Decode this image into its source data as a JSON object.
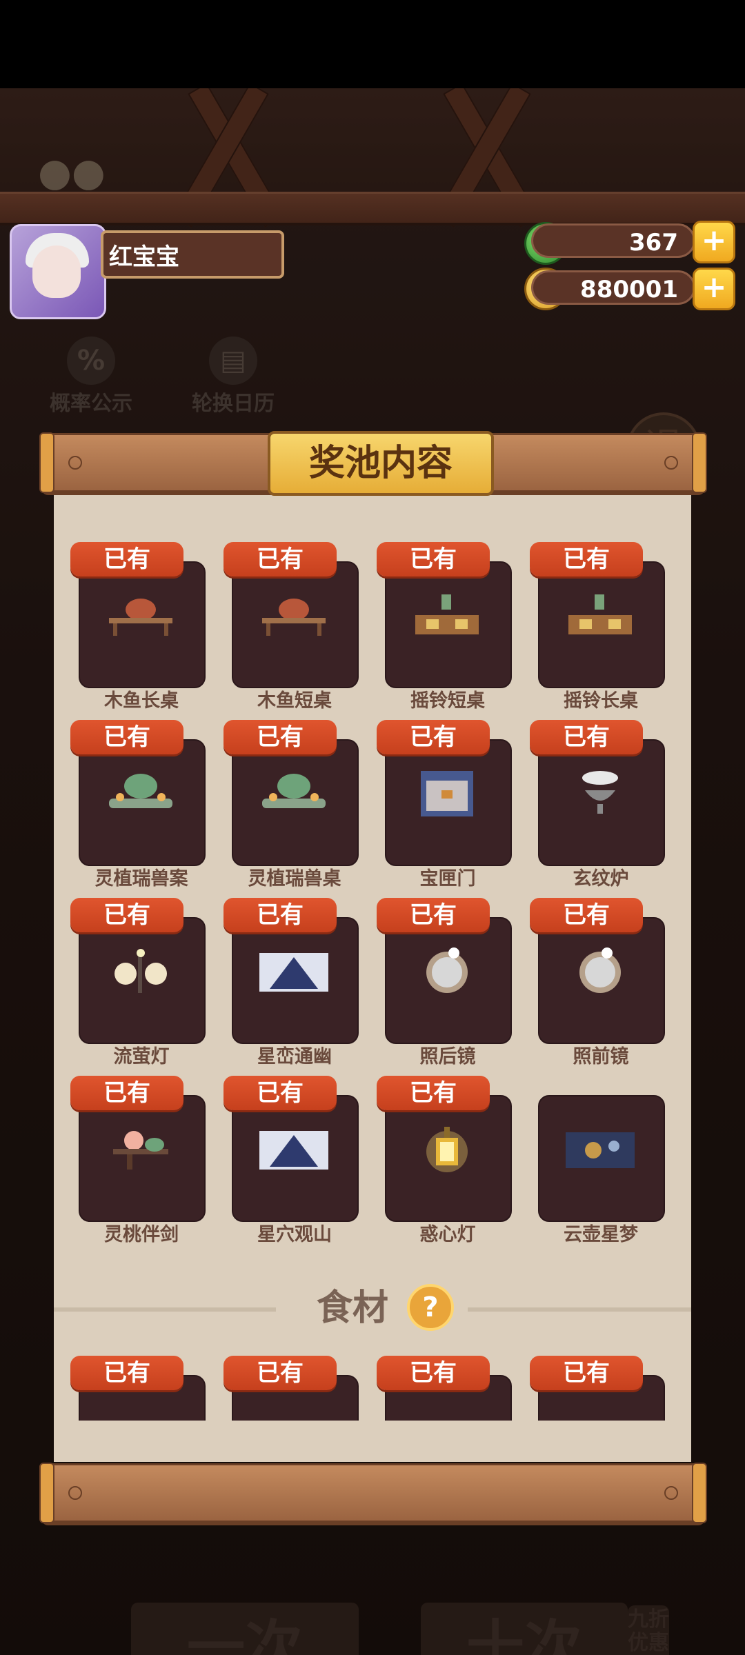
{
  "player": {
    "name": "红宝宝"
  },
  "currencies": [
    {
      "icon": "jade-coin-icon",
      "value": "367"
    },
    {
      "icon": "gold-coin-icon",
      "value": "880001"
    }
  ],
  "background": {
    "probability_label": "概率公示",
    "calendar_label": "轮换日历",
    "exit_glyph": "退",
    "single_draw": "一次",
    "ten_draw": "十次",
    "discount": "九折优惠"
  },
  "panel": {
    "title": "奖池内容",
    "owned_badge": "已有",
    "items": [
      {
        "name": "木鱼长桌",
        "owned": true,
        "icon": "wooden-fish-table-icon"
      },
      {
        "name": "木鱼短桌",
        "owned": true,
        "icon": "wooden-fish-table-icon"
      },
      {
        "name": "摇铃短桌",
        "owned": true,
        "icon": "bell-table-icon"
      },
      {
        "name": "摇铃长桌",
        "owned": true,
        "icon": "bell-table-icon"
      },
      {
        "name": "灵植瑞兽案",
        "owned": true,
        "icon": "spirit-beast-table-icon"
      },
      {
        "name": "灵植瑞兽桌",
        "owned": true,
        "icon": "spirit-beast-table-icon"
      },
      {
        "name": "宝匣门",
        "owned": true,
        "icon": "treasure-door-icon"
      },
      {
        "name": "玄纹炉",
        "owned": true,
        "icon": "incense-burner-icon"
      },
      {
        "name": "流萤灯",
        "owned": true,
        "icon": "lantern-icon"
      },
      {
        "name": "星峦通幽",
        "owned": true,
        "icon": "mountain-painting-icon"
      },
      {
        "name": "照后镜",
        "owned": true,
        "icon": "mirror-icon"
      },
      {
        "name": "照前镜",
        "owned": true,
        "icon": "mirror-icon"
      },
      {
        "name": "灵桃伴剑",
        "owned": true,
        "icon": "peach-sword-icon"
      },
      {
        "name": "星穴观山",
        "owned": true,
        "icon": "mountain-painting-icon"
      },
      {
        "name": "惑心灯",
        "owned": true,
        "icon": "golden-lantern-icon"
      },
      {
        "name": "云壶星梦",
        "owned": false,
        "icon": "cloud-painting-icon"
      }
    ],
    "section": {
      "title": "食材",
      "help_glyph": "?"
    },
    "ingredients": [
      {
        "owned": true,
        "icon": "herb-icon"
      },
      {
        "owned": true,
        "icon": "pot-icon"
      },
      {
        "owned": true,
        "icon": "leaf-icon"
      },
      {
        "owned": true,
        "icon": "bone-icon"
      }
    ]
  },
  "colors": {
    "badge": "#d44a25",
    "tile": "#3a2225",
    "parchment": "#dccfbd",
    "plaque": "#f0c552"
  }
}
